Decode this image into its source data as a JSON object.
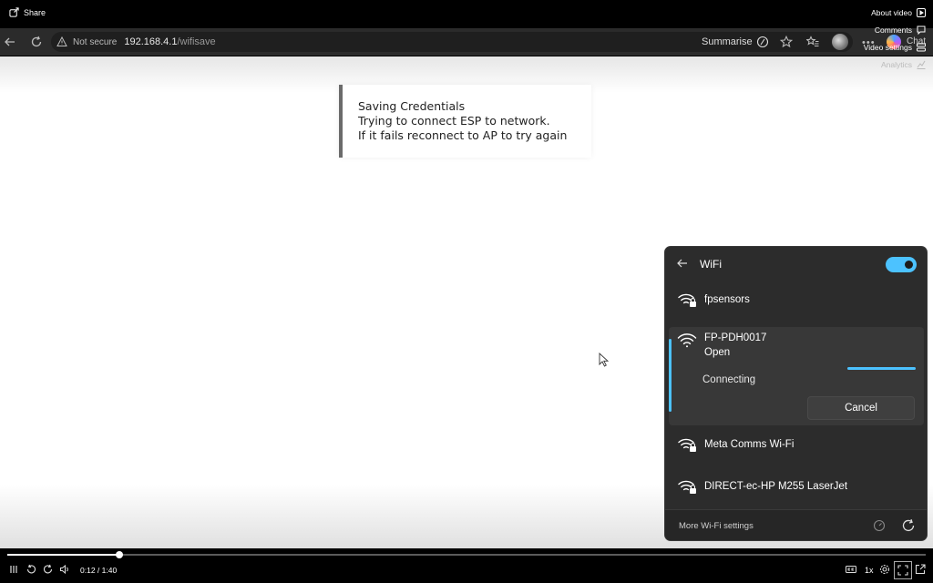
{
  "player": {
    "share_label": "Share",
    "menu": {
      "about": "About video",
      "comments": "Comments",
      "settings": "Video settings",
      "analytics": "Analytics"
    },
    "time": "0:12 / 1:40",
    "progress_fraction": 0.122,
    "speed": "1x"
  },
  "browser": {
    "not_secure": "Not secure",
    "url_host": "192.168.4.1",
    "url_path": "/wifisave",
    "summarise": "Summarise",
    "chat": "Chat"
  },
  "page": {
    "lines": [
      "Saving Credentials",
      "Trying to connect ESP to network.",
      "If it fails reconnect to AP to try again"
    ]
  },
  "wifi": {
    "title": "WiFi",
    "toggle_on": true,
    "accent_color": "#4cc2ff",
    "networks": [
      {
        "name": "fpsensors",
        "secured": true
      },
      {
        "name": "FP-PDH0017",
        "status": "Open",
        "state": "Connecting",
        "secured": false
      },
      {
        "name": "Meta Comms Wi-Fi",
        "secured": true
      },
      {
        "name": "DIRECT-ec-HP M255 LaserJet",
        "secured": true
      }
    ],
    "cancel_label": "Cancel",
    "more_settings": "More Wi-Fi settings"
  }
}
